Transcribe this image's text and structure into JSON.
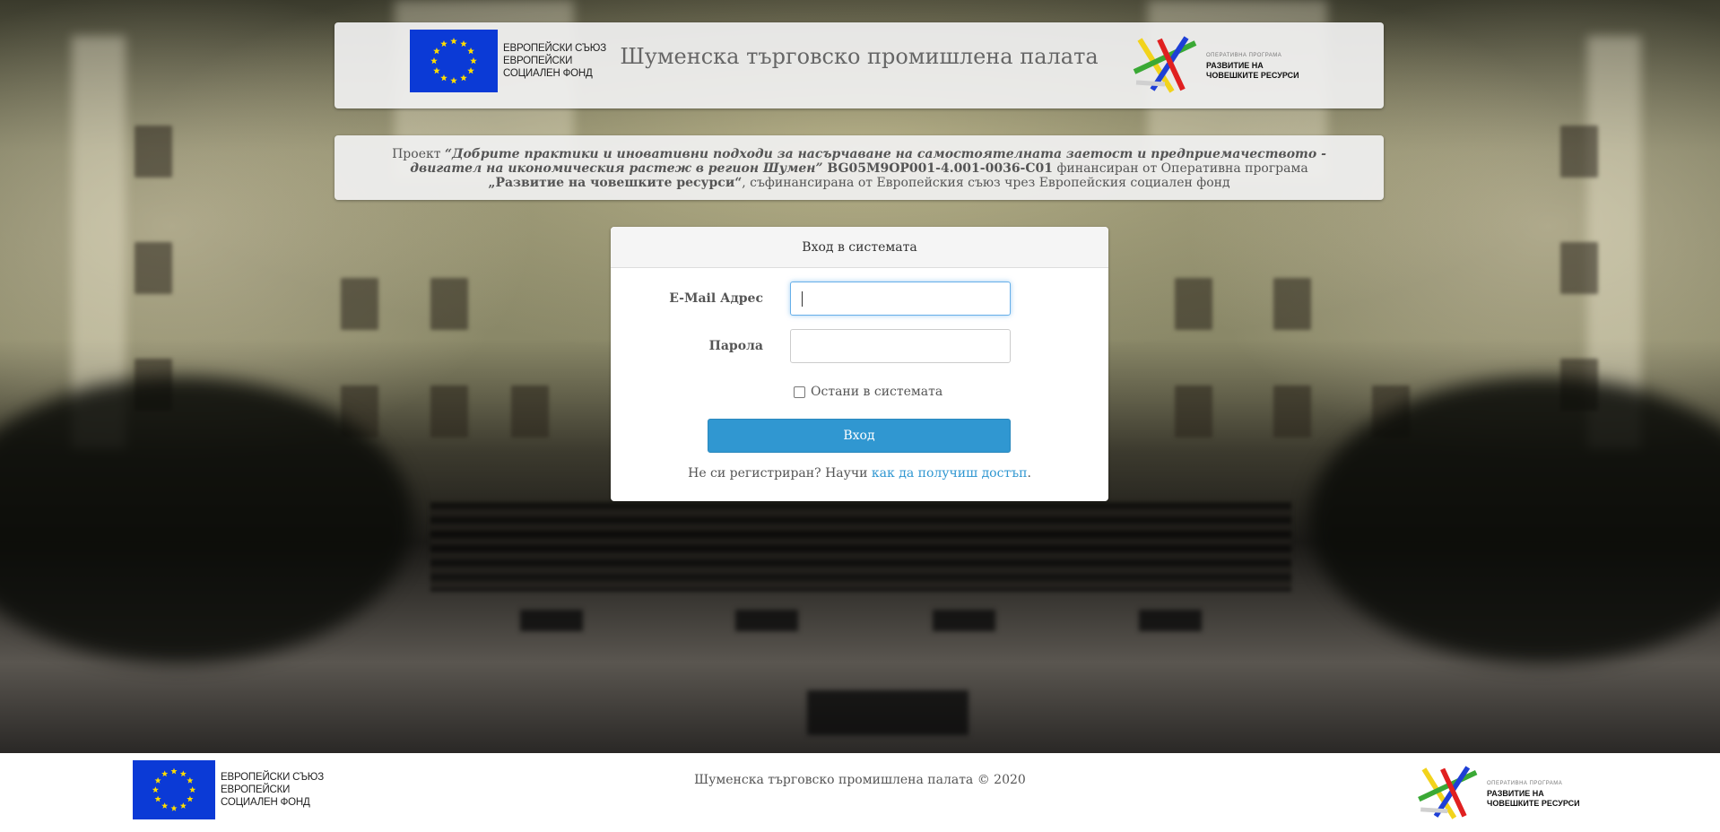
{
  "header": {
    "title": "Шуменска търговско промишлена палата",
    "eu_logo": {
      "lines": [
        "ЕВРОПЕЙСКИ СЪЮЗ",
        "ЕВРОПЕЙСКИ",
        "СОЦИАЛЕН ФОНД"
      ],
      "flag_color": "#0b3ad6",
      "star_color": "#ffdd00"
    },
    "op_logo": {
      "small_line": "ОПЕРАТИВНА ПРОГРАМА",
      "lines": [
        "РАЗВИТИЕ НА",
        "ЧОВЕШКИТЕ РЕСУРСИ"
      ]
    }
  },
  "project": {
    "prefix": "Проект ",
    "name": "“Добрите практики и иновативни подходи за насърчаване на самостоятелната заетост и предприемачеството - двигател на икономическия растеж в регион Шумен”",
    "code": " BG05M9OP001-4.001-0036-C01",
    "funded_by": " финансиран от Оперативна програма ",
    "program": "„Развитие на човешките ресурси“",
    "cofunded": ", съфинансирана от Европейския съюз чрез Европейския социален фонд"
  },
  "login": {
    "heading": "Вход в системата",
    "email_label": "E-Mail Адрес",
    "email_value": "",
    "password_label": "Парола",
    "password_value": "",
    "remember_label": "Остани в системата",
    "remember_checked": false,
    "submit_label": "Вход",
    "register_text": "Не си регистриран? Научи ",
    "register_link": "как да получиш достъп",
    "register_suffix": "."
  },
  "footer": {
    "copyright": "Шуменска търговско промишлена палата © 2020"
  },
  "colors": {
    "primary": "#3097d1",
    "panel_bg": "#f0f0f0"
  }
}
